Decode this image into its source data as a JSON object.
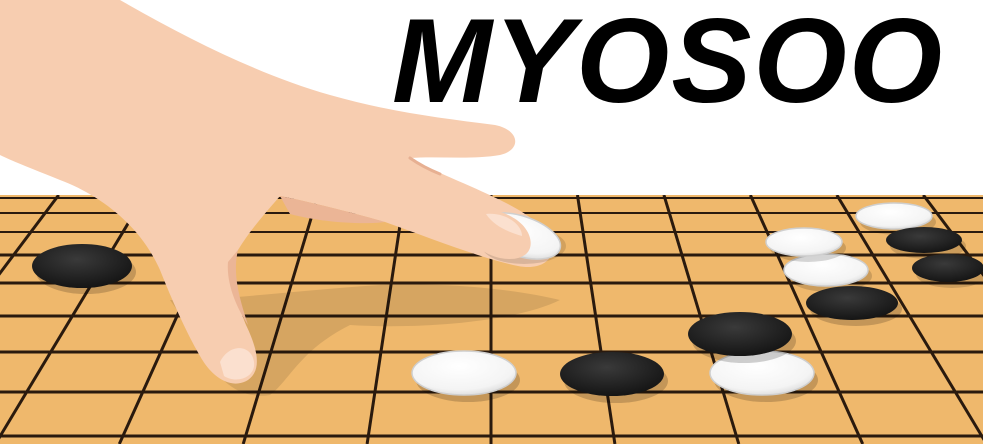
{
  "brand": {
    "name": "MYOSOO"
  },
  "colors": {
    "board_wood": "#EFB86C",
    "board_wood_dark": "#D9A05C",
    "grid_lines": "#2A1A0E",
    "black_stone": "#1E1E1E",
    "white_stone": "#FFFFFF",
    "skin": "#F7CDB0",
    "skin_shadow": "#EBB596",
    "title_text": "#000000"
  },
  "icons": {
    "board": "go-board-icon",
    "hand": "hand-icon",
    "stone_black": "black-stone-icon",
    "stone_white": "white-stone-icon"
  }
}
